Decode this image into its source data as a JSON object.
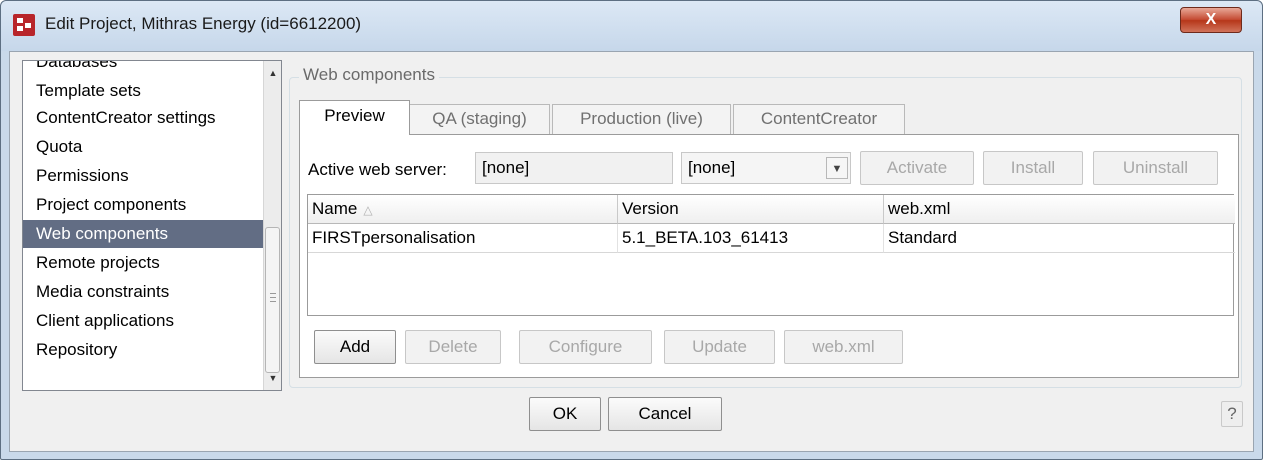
{
  "window": {
    "title": "Edit Project, Mithras Energy (id=6612200)",
    "close_label": "X",
    "app_icon": "firstspirit-logo-icon"
  },
  "sidebar": {
    "items": [
      {
        "label": "Databases",
        "selected": false
      },
      {
        "label": "Template sets",
        "selected": false
      },
      {
        "label": "ContentCreator settings",
        "selected": false
      },
      {
        "label": "Quota",
        "selected": false
      },
      {
        "label": "Permissions",
        "selected": false
      },
      {
        "label": "Project components",
        "selected": false
      },
      {
        "label": "Web components",
        "selected": true
      },
      {
        "label": "Remote projects",
        "selected": false
      },
      {
        "label": "Media constraints",
        "selected": false
      },
      {
        "label": "Client applications",
        "selected": false
      },
      {
        "label": "Repository",
        "selected": false
      }
    ],
    "scroll_up": "▲",
    "scroll_down": "▼"
  },
  "group": {
    "title": "Web components",
    "tabs": [
      {
        "label": "Preview",
        "active": true
      },
      {
        "label": "QA (staging)",
        "active": false
      },
      {
        "label": "Production (live)",
        "active": false
      },
      {
        "label": "ContentCreator",
        "active": false
      }
    ]
  },
  "server": {
    "label": "Active web server:",
    "field_value": "[none]",
    "select_value": "[none]",
    "select_arrow": "▼",
    "activate_label": "Activate",
    "install_label": "Install",
    "uninstall_label": "Uninstall"
  },
  "table": {
    "columns": [
      "Name",
      "Version",
      "web.xml"
    ],
    "sort_indicator": "△",
    "rows": [
      [
        "FIRSTpersonalisation",
        "5.1_BETA.103_61413",
        "Standard"
      ]
    ]
  },
  "actions": {
    "add": "Add",
    "delete": "Delete",
    "configure": "Configure",
    "update": "Update",
    "webxml": "web.xml"
  },
  "footer": {
    "ok": "OK",
    "cancel": "Cancel",
    "help": "?"
  },
  "colors": {
    "selection": "#626d84",
    "close_button": "#c54b33",
    "title_bar": "#c6d7ea"
  }
}
